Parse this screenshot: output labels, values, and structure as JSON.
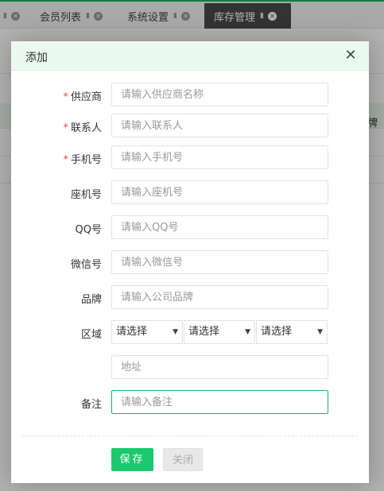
{
  "tabs": [
    {
      "label": "会员列表"
    },
    {
      "label": "系统设置"
    },
    {
      "label": "库存管理",
      "active": true
    }
  ],
  "background": {
    "right_cell": "牌"
  },
  "dialog": {
    "title": "添加",
    "close_symbol": "✕",
    "fields": [
      {
        "label": "供应商",
        "required": true,
        "placeholder": "请输入供应商名称"
      },
      {
        "label": "联系人",
        "required": true,
        "placeholder": "请输入联系人"
      },
      {
        "label": "手机号",
        "required": true,
        "placeholder": "请输入手机号"
      },
      {
        "label": "座机号",
        "required": false,
        "placeholder": "请输入座机号"
      },
      {
        "label": "QQ号",
        "required": false,
        "placeholder": "请输入QQ号"
      },
      {
        "label": "微信号",
        "required": false,
        "placeholder": "请输入微信号"
      },
      {
        "label": "品牌",
        "required": false,
        "placeholder": "请输入公司品牌"
      }
    ],
    "region": {
      "label": "区域",
      "selects": [
        "请选择",
        "请选择",
        "请选择"
      ],
      "address_placeholder": "地址"
    },
    "remark": {
      "label": "备注",
      "placeholder": "请输入备注"
    },
    "required_mark": "*",
    "save_label": "保存",
    "close_label": "关闭"
  },
  "colors": {
    "accent": "#1ec86e",
    "header_bg": "#eafaf0",
    "required": "#e64c3c"
  }
}
